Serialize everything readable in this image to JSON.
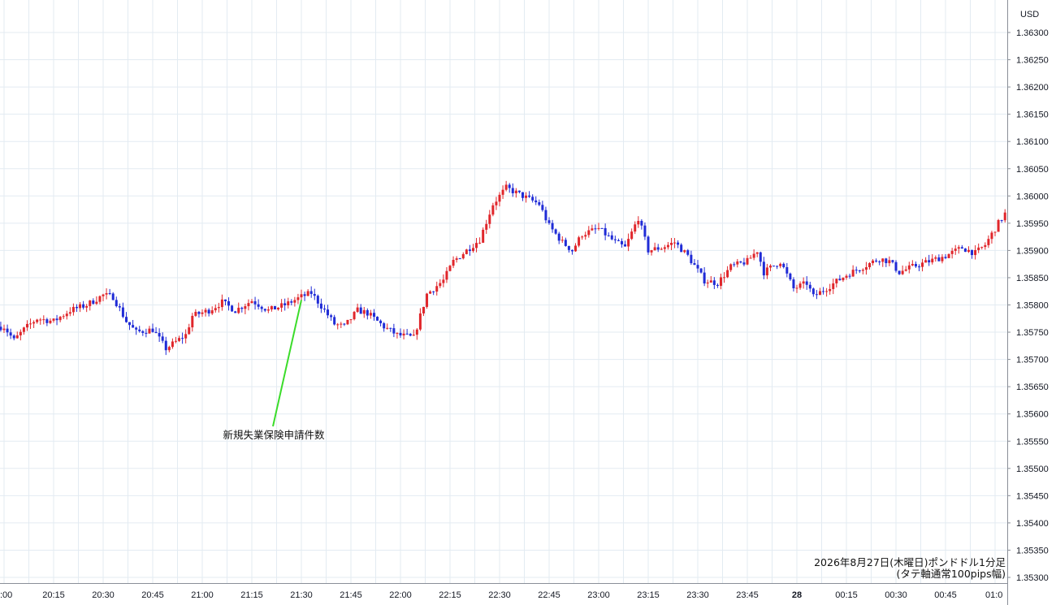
{
  "chart_data": {
    "type": "candlestick",
    "currency_label": "USD",
    "caption_lines": [
      "2026年8月27日(木曜日)ポンドドル1分足",
      "(タテ軸通常100pips幅)"
    ],
    "annotation": {
      "text": "新規失業保険申請件数",
      "x": "21:30"
    },
    "x_tick_labels": [
      ":00",
      "20:15",
      "20:30",
      "20:45",
      "21:00",
      "21:15",
      "21:30",
      "21:45",
      "22:00",
      "22:15",
      "22:30",
      "22:45",
      "23:00",
      "23:15",
      "23:30",
      "23:45",
      "28",
      "00:15",
      "00:30",
      "00:45",
      "01:0"
    ],
    "y_tick_labels": [
      "1.36300",
      "1.36250",
      "1.36200",
      "1.36150",
      "1.36100",
      "1.36050",
      "1.36000",
      "1.35950",
      "1.35900",
      "1.35850",
      "1.35800",
      "1.35750",
      "1.35700",
      "1.35650",
      "1.35600",
      "1.35550",
      "1.35500",
      "1.35450",
      "1.35400",
      "1.35350",
      "1.35300"
    ],
    "ylim": [
      1.353,
      1.363
    ],
    "time_range_minutes": [
      -1,
      307
    ],
    "grid": true,
    "colors": {
      "up": "#e0262b",
      "down": "#1f2bd6",
      "grid": "#e3ebf2",
      "annotation_line": "#3bdc2a",
      "text": "#131722"
    },
    "close_path_anchors": [
      [
        0,
        1.3576
      ],
      [
        3,
        1.35735
      ],
      [
        6,
        1.35755
      ],
      [
        10,
        1.35775
      ],
      [
        15,
        1.3577
      ],
      [
        20,
        1.3579
      ],
      [
        25,
        1.358
      ],
      [
        30,
        1.35818
      ],
      [
        33,
        1.35815
      ],
      [
        37,
        1.3577
      ],
      [
        40,
        1.3575
      ],
      [
        45,
        1.35755
      ],
      [
        49,
        1.3572
      ],
      [
        55,
        1.35745
      ],
      [
        57,
        1.3578
      ],
      [
        62,
        1.3579
      ],
      [
        66,
        1.35805
      ],
      [
        70,
        1.3579
      ],
      [
        75,
        1.35808
      ],
      [
        80,
        1.3579
      ],
      [
        85,
        1.358
      ],
      [
        90,
        1.35815
      ],
      [
        93,
        1.35822
      ],
      [
        97,
        1.3579
      ],
      [
        100,
        1.35765
      ],
      [
        103,
        1.3576
      ],
      [
        107,
        1.3579
      ],
      [
        110,
        1.35785
      ],
      [
        115,
        1.3576
      ],
      [
        119,
        1.35745
      ],
      [
        124,
        1.3574
      ],
      [
        125,
        1.3576
      ],
      [
        128,
        1.3582
      ],
      [
        133,
        1.35845
      ],
      [
        136,
        1.3588
      ],
      [
        140,
        1.359
      ],
      [
        144,
        1.3592
      ],
      [
        148,
        1.35985
      ],
      [
        152,
        1.36015
      ],
      [
        157,
        1.36
      ],
      [
        162,
        1.35985
      ],
      [
        165,
        1.35945
      ],
      [
        169,
        1.35915
      ],
      [
        172,
        1.359
      ],
      [
        175,
        1.3593
      ],
      [
        180,
        1.3594
      ],
      [
        185,
        1.35915
      ],
      [
        188,
        1.35905
      ],
      [
        192,
        1.3596
      ],
      [
        195,
        1.359
      ],
      [
        199,
        1.35905
      ],
      [
        203,
        1.35915
      ],
      [
        207,
        1.3589
      ],
      [
        212,
        1.35845
      ],
      [
        216,
        1.3584
      ],
      [
        220,
        1.3587
      ],
      [
        225,
        1.3588
      ],
      [
        228,
        1.359
      ],
      [
        230,
        1.3586
      ],
      [
        235,
        1.3588
      ],
      [
        239,
        1.3583
      ],
      [
        243,
        1.3584
      ],
      [
        245,
        1.35815
      ],
      [
        250,
        1.35835
      ],
      [
        255,
        1.35855
      ],
      [
        260,
        1.3587
      ],
      [
        265,
        1.35885
      ],
      [
        268,
        1.3588
      ],
      [
        271,
        1.3586
      ],
      [
        275,
        1.3587
      ],
      [
        280,
        1.3588
      ],
      [
        285,
        1.3589
      ],
      [
        290,
        1.35905
      ],
      [
        294,
        1.35895
      ],
      [
        297,
        1.3591
      ],
      [
        301,
        1.3595
      ],
      [
        305,
        1.35985
      ]
    ]
  }
}
